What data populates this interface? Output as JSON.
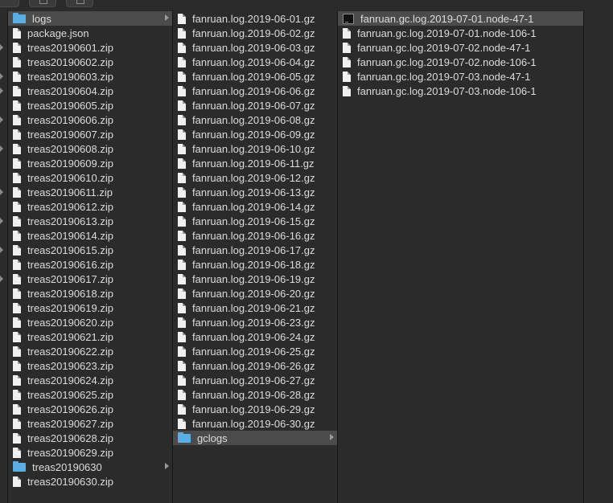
{
  "toolbar": {
    "buttons": [
      "back-forward-icon",
      "share-icon",
      "tag-icon"
    ]
  },
  "columns": [
    {
      "items": [
        {
          "label": "logs",
          "kind": "folder",
          "selected": true,
          "expandable": true
        },
        {
          "label": "package.json",
          "kind": "file"
        },
        {
          "label": "treas20190601.zip",
          "kind": "file"
        },
        {
          "label": "treas20190602.zip",
          "kind": "file"
        },
        {
          "label": "treas20190603.zip",
          "kind": "file"
        },
        {
          "label": "treas20190604.zip",
          "kind": "file"
        },
        {
          "label": "treas20190605.zip",
          "kind": "file"
        },
        {
          "label": "treas20190606.zip",
          "kind": "file"
        },
        {
          "label": "treas20190607.zip",
          "kind": "file"
        },
        {
          "label": "treas20190608.zip",
          "kind": "file"
        },
        {
          "label": "treas20190609.zip",
          "kind": "file"
        },
        {
          "label": "treas20190610.zip",
          "kind": "file"
        },
        {
          "label": "treas20190611.zip",
          "kind": "file"
        },
        {
          "label": "treas20190612.zip",
          "kind": "file"
        },
        {
          "label": "treas20190613.zip",
          "kind": "file"
        },
        {
          "label": "treas20190614.zip",
          "kind": "file"
        },
        {
          "label": "treas20190615.zip",
          "kind": "file"
        },
        {
          "label": "treas20190616.zip",
          "kind": "file"
        },
        {
          "label": "treas20190617.zip",
          "kind": "file"
        },
        {
          "label": "treas20190618.zip",
          "kind": "file"
        },
        {
          "label": "treas20190619.zip",
          "kind": "file"
        },
        {
          "label": "treas20190620.zip",
          "kind": "file"
        },
        {
          "label": "treas20190621.zip",
          "kind": "file"
        },
        {
          "label": "treas20190622.zip",
          "kind": "file"
        },
        {
          "label": "treas20190623.zip",
          "kind": "file"
        },
        {
          "label": "treas20190624.zip",
          "kind": "file"
        },
        {
          "label": "treas20190625.zip",
          "kind": "file"
        },
        {
          "label": "treas20190626.zip",
          "kind": "file"
        },
        {
          "label": "treas20190627.zip",
          "kind": "file"
        },
        {
          "label": "treas20190628.zip",
          "kind": "file"
        },
        {
          "label": "treas20190629.zip",
          "kind": "file"
        },
        {
          "label": "treas20190630",
          "kind": "folder",
          "expandable": true
        },
        {
          "label": "treas20190630.zip",
          "kind": "file"
        }
      ]
    },
    {
      "items": [
        {
          "label": "fanruan.log.2019-06-01.gz",
          "kind": "file"
        },
        {
          "label": "fanruan.log.2019-06-02.gz",
          "kind": "file"
        },
        {
          "label": "fanruan.log.2019-06-03.gz",
          "kind": "file"
        },
        {
          "label": "fanruan.log.2019-06-04.gz",
          "kind": "file"
        },
        {
          "label": "fanruan.log.2019-06-05.gz",
          "kind": "file"
        },
        {
          "label": "fanruan.log.2019-06-06.gz",
          "kind": "file"
        },
        {
          "label": "fanruan.log.2019-06-07.gz",
          "kind": "file"
        },
        {
          "label": "fanruan.log.2019-06-08.gz",
          "kind": "file"
        },
        {
          "label": "fanruan.log.2019-06-09.gz",
          "kind": "file"
        },
        {
          "label": "fanruan.log.2019-06-10.gz",
          "kind": "file"
        },
        {
          "label": "fanruan.log.2019-06-11.gz",
          "kind": "file"
        },
        {
          "label": "fanruan.log.2019-06-12.gz",
          "kind": "file"
        },
        {
          "label": "fanruan.log.2019-06-13.gz",
          "kind": "file"
        },
        {
          "label": "fanruan.log.2019-06-14.gz",
          "kind": "file"
        },
        {
          "label": "fanruan.log.2019-06-15.gz",
          "kind": "file"
        },
        {
          "label": "fanruan.log.2019-06-16.gz",
          "kind": "file"
        },
        {
          "label": "fanruan.log.2019-06-17.gz",
          "kind": "file"
        },
        {
          "label": "fanruan.log.2019-06-18.gz",
          "kind": "file"
        },
        {
          "label": "fanruan.log.2019-06-19.gz",
          "kind": "file"
        },
        {
          "label": "fanruan.log.2019-06-20.gz",
          "kind": "file"
        },
        {
          "label": "fanruan.log.2019-06-21.gz",
          "kind": "file"
        },
        {
          "label": "fanruan.log.2019-06-23.gz",
          "kind": "file"
        },
        {
          "label": "fanruan.log.2019-06-24.gz",
          "kind": "file"
        },
        {
          "label": "fanruan.log.2019-06-25.gz",
          "kind": "file"
        },
        {
          "label": "fanruan.log.2019-06-26.gz",
          "kind": "file"
        },
        {
          "label": "fanruan.log.2019-06-27.gz",
          "kind": "file"
        },
        {
          "label": "fanruan.log.2019-06-28.gz",
          "kind": "file"
        },
        {
          "label": "fanruan.log.2019-06-29.gz",
          "kind": "file"
        },
        {
          "label": "fanruan.log.2019-06-30.gz",
          "kind": "file"
        },
        {
          "label": "gclogs",
          "kind": "folder",
          "selected": true,
          "expandable": true
        }
      ]
    },
    {
      "items": [
        {
          "label": "fanruan.gc.log.2019-07-01.node-47-1",
          "kind": "exec",
          "selected": true
        },
        {
          "label": "fanruan.gc.log.2019-07-01.node-106-1",
          "kind": "file"
        },
        {
          "label": "fanruan.gc.log.2019-07-02.node-47-1",
          "kind": "file"
        },
        {
          "label": "fanruan.gc.log.2019-07-02.node-106-1",
          "kind": "file"
        },
        {
          "label": "fanruan.gc.log.2019-07-03.node-47-1",
          "kind": "file"
        },
        {
          "label": "fanruan.gc.log.2019-07-03.node-106-1",
          "kind": "file"
        }
      ]
    }
  ],
  "left_edge_marks": [
    2,
    4,
    5,
    7,
    9,
    12,
    14,
    16,
    18
  ]
}
